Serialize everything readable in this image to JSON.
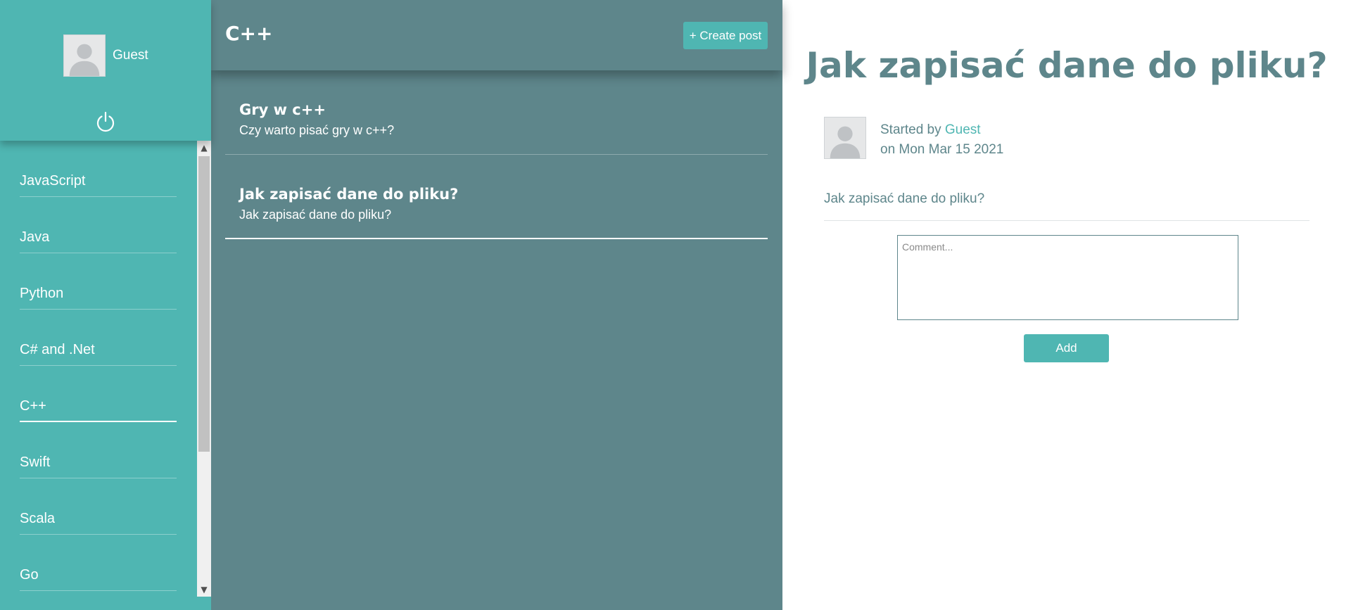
{
  "user": {
    "name": "Guest",
    "avatar_icon": "user-silhouette-icon",
    "logout_icon": "power-icon"
  },
  "sidebar": {
    "active_index": 4,
    "items": [
      {
        "label": "JavaScript"
      },
      {
        "label": "Java"
      },
      {
        "label": "Python"
      },
      {
        "label": "C# and .Net"
      },
      {
        "label": "C++"
      },
      {
        "label": "Swift"
      },
      {
        "label": "Scala"
      },
      {
        "label": "Go"
      }
    ]
  },
  "scrollbar": {
    "up_icon": "chevron-up-icon",
    "down_icon": "chevron-down-icon"
  },
  "middle": {
    "title": "C++",
    "create_button": "+ Create post",
    "active_index": 1,
    "posts": [
      {
        "title": "Gry w c++",
        "subtitle": "Czy warto pisać gry w c++?"
      },
      {
        "title": "Jak zapisać dane do pliku?",
        "subtitle": "Jak zapisać dane do pliku?"
      }
    ]
  },
  "detail": {
    "title": "Jak zapisać dane do pliku?",
    "started_by_label": "Started by",
    "author": "Guest",
    "date_text": "on Mon Mar 15 2021",
    "body": "Jak zapisać dane do pliku?",
    "comment_placeholder": "Comment...",
    "add_button": "Add"
  },
  "colors": {
    "teal": "#4fb6b2",
    "slate": "#5e868b",
    "white": "#ffffff"
  }
}
